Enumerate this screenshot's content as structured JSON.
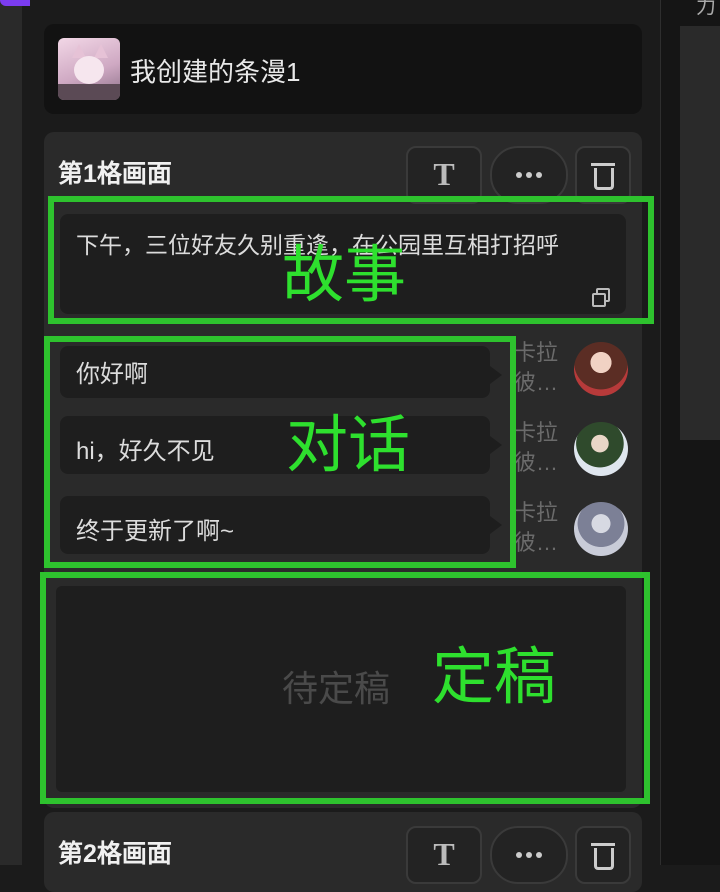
{
  "comic": {
    "title": "我创建的条漫1"
  },
  "frames": [
    {
      "title": "第1格画面",
      "text_button": "T",
      "story_text": "下午，三位好友久别重逢，在公园里互相打招呼",
      "dialogues": [
        {
          "text": "你好啊",
          "speaker_line1": "卡拉",
          "speaker_line2": "彼…"
        },
        {
          "text": "hi，好久不见",
          "speaker_line1": "卡拉",
          "speaker_line2": "彼…"
        },
        {
          "text": "终于更新了啊~",
          "speaker_line1": "卡拉",
          "speaker_line2": "彼…"
        }
      ],
      "final_placeholder": "待定稿"
    },
    {
      "title": "第2格画面",
      "text_button": "T"
    }
  ],
  "annotations": {
    "story": "故事",
    "dialogue": "对话",
    "final": "定稿"
  },
  "colors": {
    "accent_purple": "#7b3cf0",
    "annotation_green": "#2ec22e"
  }
}
